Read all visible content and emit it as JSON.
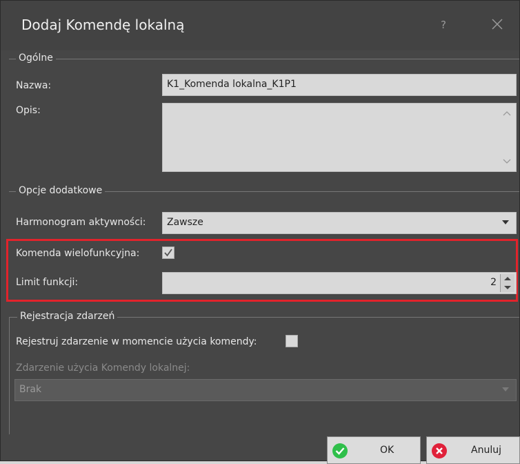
{
  "window": {
    "title": "Dodaj Komendę lokalną"
  },
  "general": {
    "legend": "Ogólne",
    "name_label": "Nazwa:",
    "name_value": "K1_Komenda lokalna_K1P1",
    "description_label": "Opis:",
    "description_value": ""
  },
  "additional": {
    "legend": "Opcje dodatkowe",
    "schedule_label": "Harmonogram aktywności:",
    "schedule_value": "Zawsze",
    "multifunction_label": "Komenda wielofunkcyjna:",
    "multifunction_checked": true,
    "limit_label": "Limit funkcji:",
    "limit_value": "2"
  },
  "events": {
    "legend": "Rejestracja zdarzeń",
    "register_label": "Rejestruj zdarzenie w momencie użycia komendy:",
    "register_checked": false,
    "event_label": "Zdarzenie użycia Komendy lokalnej:",
    "event_value": "Brak"
  },
  "buttons": {
    "ok_label": "OK",
    "cancel_label": "Anuluj"
  },
  "colors": {
    "highlight": "#e2232b",
    "ok_icon": "#2fbf4a",
    "cancel_icon": "#e0213a"
  }
}
